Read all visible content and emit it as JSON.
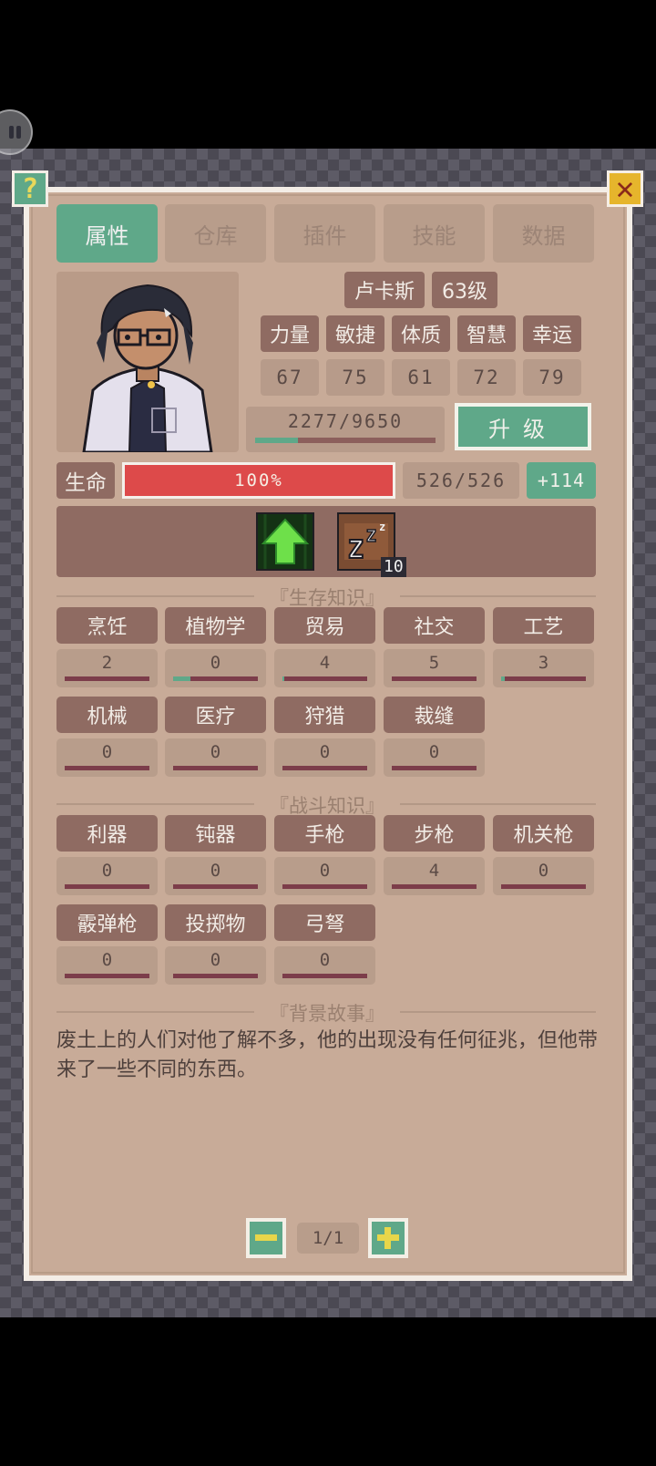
{
  "tabs": [
    {
      "label": "属性",
      "active": true
    },
    {
      "label": "仓库",
      "active": false
    },
    {
      "label": "插件",
      "active": false
    },
    {
      "label": "技能",
      "active": false
    },
    {
      "label": "数据",
      "active": false
    }
  ],
  "character": {
    "name": "卢卡斯",
    "level": "63级",
    "stats": [
      {
        "label": "力量",
        "value": "67"
      },
      {
        "label": "敏捷",
        "value": "75"
      },
      {
        "label": "体质",
        "value": "61"
      },
      {
        "label": "智慧",
        "value": "72"
      },
      {
        "label": "幸运",
        "value": "79"
      }
    ],
    "xp": {
      "text": "2277/9650",
      "fraction": 0.236
    },
    "upgrade_label": "升级",
    "hp": {
      "label": "生命",
      "percent_text": "100%",
      "fraction": 1.0,
      "value": "526/526",
      "regen": "+114"
    }
  },
  "buffs": [
    {
      "icon": "level-up-arrow-icon"
    },
    {
      "icon": "sleep-zzz-icon",
      "count": "10"
    }
  ],
  "sections": {
    "survival_title": "『生存知识』",
    "combat_title": "『战斗知识』",
    "story_title": "『背景故事』"
  },
  "survival_skills": [
    {
      "label": "烹饪",
      "value": "2",
      "progress": 0.0
    },
    {
      "label": "植物学",
      "value": "0",
      "progress": 0.2
    },
    {
      "label": "贸易",
      "value": "4",
      "progress": 0.02
    },
    {
      "label": "社交",
      "value": "5",
      "progress": 0.0
    },
    {
      "label": "工艺",
      "value": "3",
      "progress": 0.04
    },
    {
      "label": "机械",
      "value": "0",
      "progress": 0.0
    },
    {
      "label": "医疗",
      "value": "0",
      "progress": 0.0
    },
    {
      "label": "狩猎",
      "value": "0",
      "progress": 0.0
    },
    {
      "label": "裁缝",
      "value": "0",
      "progress": 0.0
    }
  ],
  "combat_skills": [
    {
      "label": "利器",
      "value": "0",
      "progress": 0.0
    },
    {
      "label": "钝器",
      "value": "0",
      "progress": 0.0
    },
    {
      "label": "手枪",
      "value": "0",
      "progress": 0.0
    },
    {
      "label": "步枪",
      "value": "4",
      "progress": 0.0
    },
    {
      "label": "机关枪",
      "value": "0",
      "progress": 0.0
    },
    {
      "label": "霰弹枪",
      "value": "0",
      "progress": 0.0
    },
    {
      "label": "投掷物",
      "value": "0",
      "progress": 0.0
    },
    {
      "label": "弓弩",
      "value": "0",
      "progress": 0.0
    }
  ],
  "story_text": "废土上的人们对他了解不多，他的出现没有任何征兆，但他带来了一些不同的东西。",
  "pager": {
    "text": "1/1"
  },
  "colors": {
    "accent": "#5fa889",
    "panel": "#c8ab98",
    "chip": "#8f6b62",
    "hp": "#dd4a4a"
  }
}
